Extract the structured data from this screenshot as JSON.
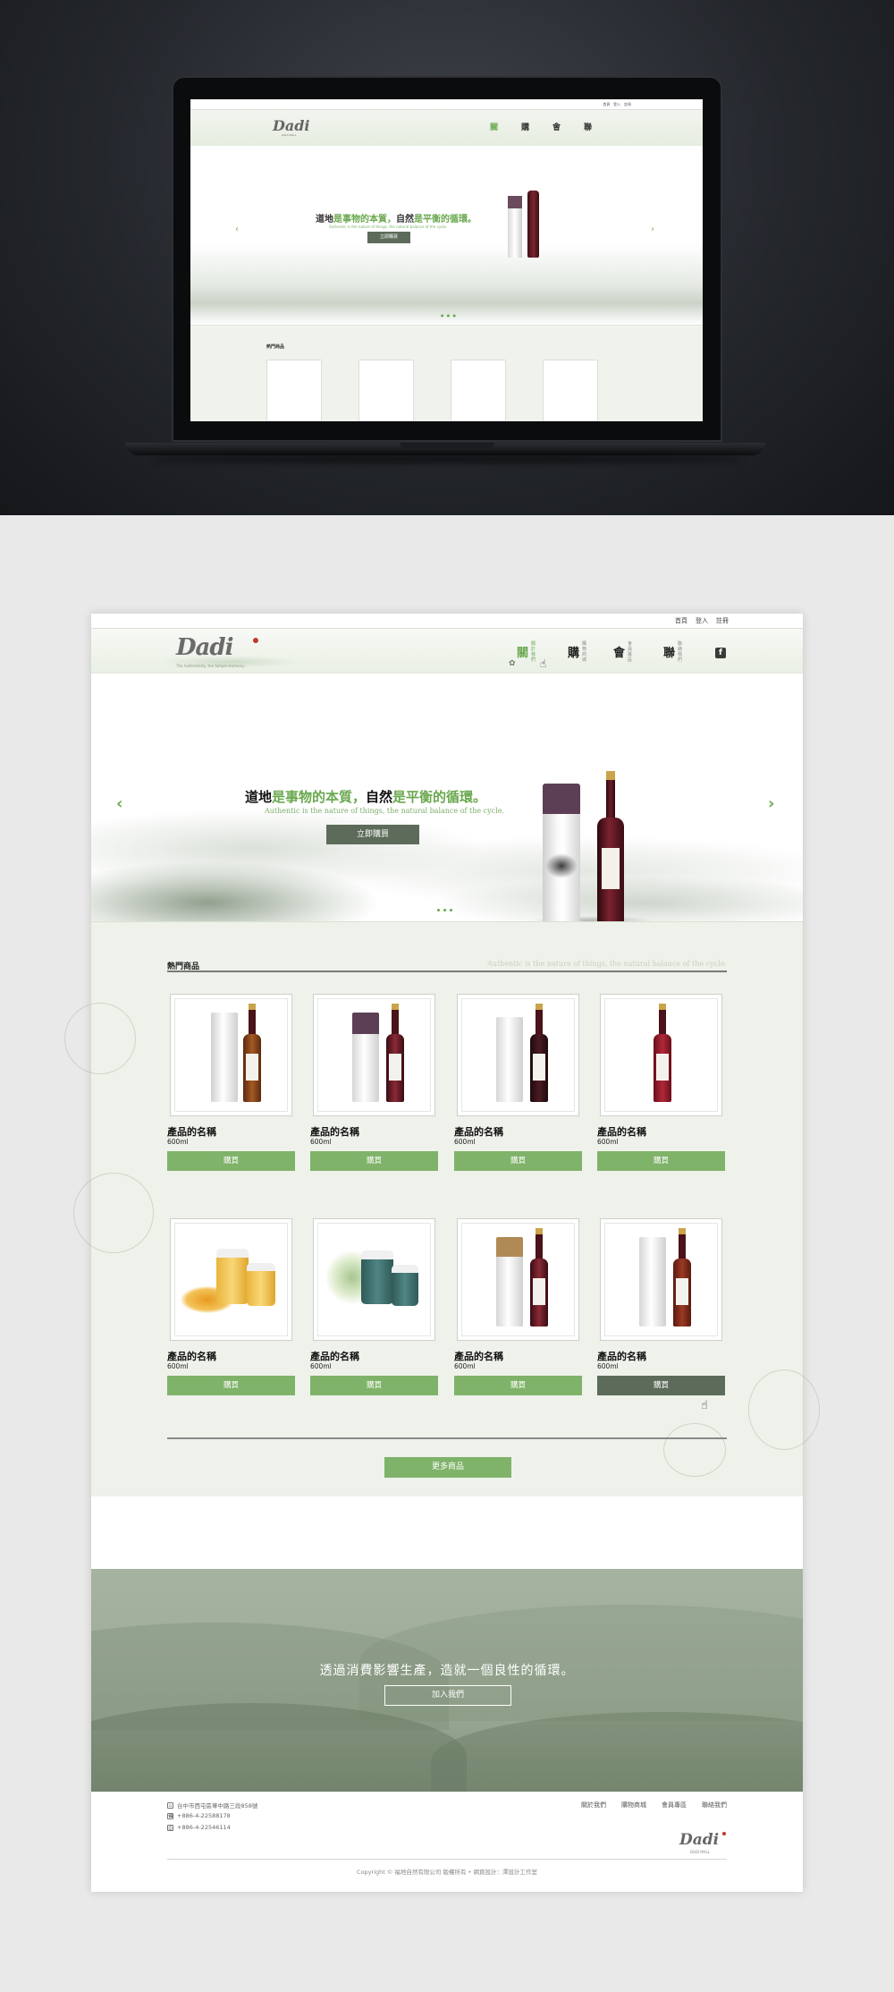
{
  "utility_nav": [
    "首頁",
    "登入",
    "註冊"
  ],
  "brand": {
    "logo": "Dadi",
    "tagline": "The Authenticity, the Simple Harmony",
    "mini_tagline": "DADI MALL"
  },
  "main_nav": [
    {
      "char": "關",
      "sub": "關於我們"
    },
    {
      "char": "購",
      "sub": "購物商城"
    },
    {
      "char": "會",
      "sub": "會員專區"
    },
    {
      "char": "聯",
      "sub": "聯絡我們"
    }
  ],
  "hero": {
    "title_parts": [
      "道地",
      "是事物的本質，",
      "自然",
      "是平衡的循環。"
    ],
    "subtitle": "Authentic is the nature of things, the natural balance of the cycle.",
    "cta": "立即購買",
    "prev_arrow": "‹",
    "next_arrow": "›"
  },
  "products": {
    "title": "熱門商品",
    "tagline": "Authentic is the nature of things, the natural balance of the cycle.",
    "items": [
      {
        "name": "產品的名稱",
        "volume": "600ml",
        "buy": "購買"
      },
      {
        "name": "產品的名稱",
        "volume": "600ml",
        "buy": "購買"
      },
      {
        "name": "產品的名稱",
        "volume": "600ml",
        "buy": "購買"
      },
      {
        "name": "產品的名稱",
        "volume": "600ml",
        "buy": "購買"
      },
      {
        "name": "產品的名稱",
        "volume": "600ml",
        "buy": "購買"
      },
      {
        "name": "產品的名稱",
        "volume": "600ml",
        "buy": "購買"
      },
      {
        "name": "產品的名稱",
        "volume": "600ml",
        "buy": "購買"
      },
      {
        "name": "產品的名稱",
        "volume": "600ml",
        "buy": "購買"
      }
    ],
    "more": "更多商品"
  },
  "join": {
    "title": "透過消費影響生產，造就一個良性的循環。",
    "cta": "加入我們"
  },
  "footer": {
    "address": "台中市西屯區華中路三段858號",
    "phone": "+886-4-22588178",
    "fax": "+886-4-22546114",
    "links": [
      "關於我們",
      "購物商城",
      "會員專區",
      "聯絡我們"
    ],
    "logo": "Dadi",
    "logo_sub": "DADI MALL",
    "copyright": "Copyright © 福地自然有限公司 版權所有 • 網頁設計：澤設計工作室"
  },
  "colors": {
    "accent_green": "#80b36a",
    "dark_green": "#5d6c5a",
    "brand_red": "#c0392b"
  }
}
